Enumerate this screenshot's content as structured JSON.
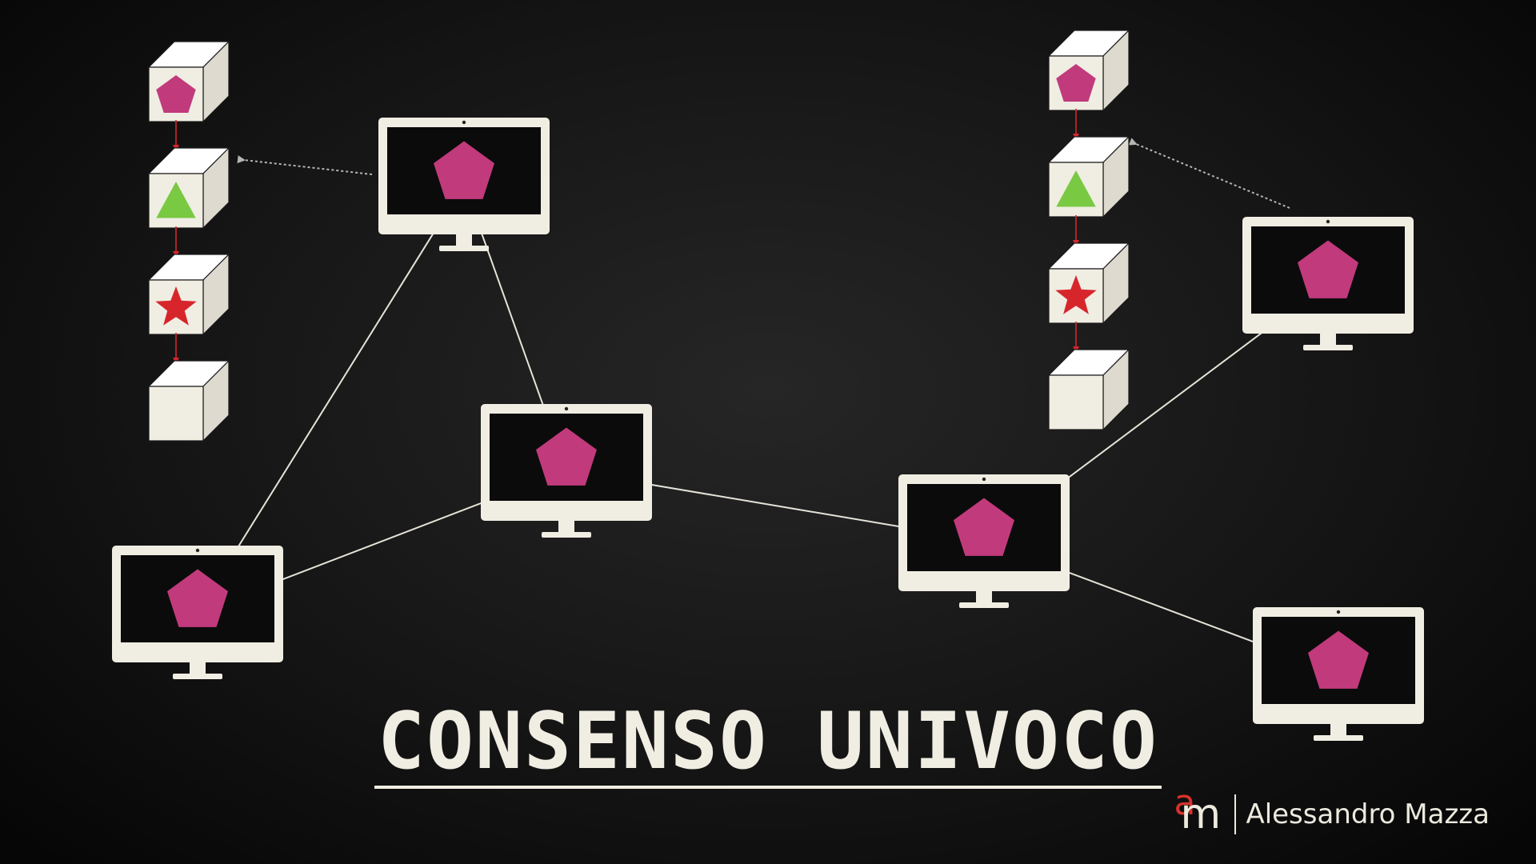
{
  "title": "CONSENSO UNIVOCO",
  "author": "Alessandro Mazza",
  "logo": {
    "a": "a",
    "m": "m"
  },
  "colors": {
    "background": "#111111",
    "device": "#f0ede3",
    "pentagon": "#c13a7c",
    "triangle": "#7ac943",
    "star": "#d7262b",
    "chain_arrow": "#d7262b",
    "link_line": "#e6e3d8",
    "pointer_arrow": "#b5b5b5",
    "logo_accent": "#d8322b"
  },
  "left_chain": {
    "blocks": [
      {
        "shape": "pentagon-icon"
      },
      {
        "shape": "triangle-icon"
      },
      {
        "shape": "star-icon"
      },
      {
        "shape": "empty"
      }
    ]
  },
  "right_chain": {
    "blocks": [
      {
        "shape": "pentagon-icon"
      },
      {
        "shape": "triangle-icon"
      },
      {
        "shape": "star-icon"
      },
      {
        "shape": "empty"
      }
    ]
  },
  "network": {
    "nodes": [
      {
        "id": "top-left",
        "icon": "pentagon-icon"
      },
      {
        "id": "center-left",
        "icon": "pentagon-icon"
      },
      {
        "id": "bottom-left",
        "icon": "pentagon-icon"
      },
      {
        "id": "center-right",
        "icon": "pentagon-icon"
      },
      {
        "id": "top-right",
        "icon": "pentagon-icon"
      },
      {
        "id": "bottom-right",
        "icon": "pentagon-icon"
      }
    ],
    "links": [
      [
        "top-left",
        "bottom-left"
      ],
      [
        "top-left",
        "center-left"
      ],
      [
        "bottom-left",
        "center-left"
      ],
      [
        "center-left",
        "center-right"
      ],
      [
        "center-right",
        "top-right"
      ],
      [
        "center-right",
        "bottom-right"
      ]
    ]
  }
}
